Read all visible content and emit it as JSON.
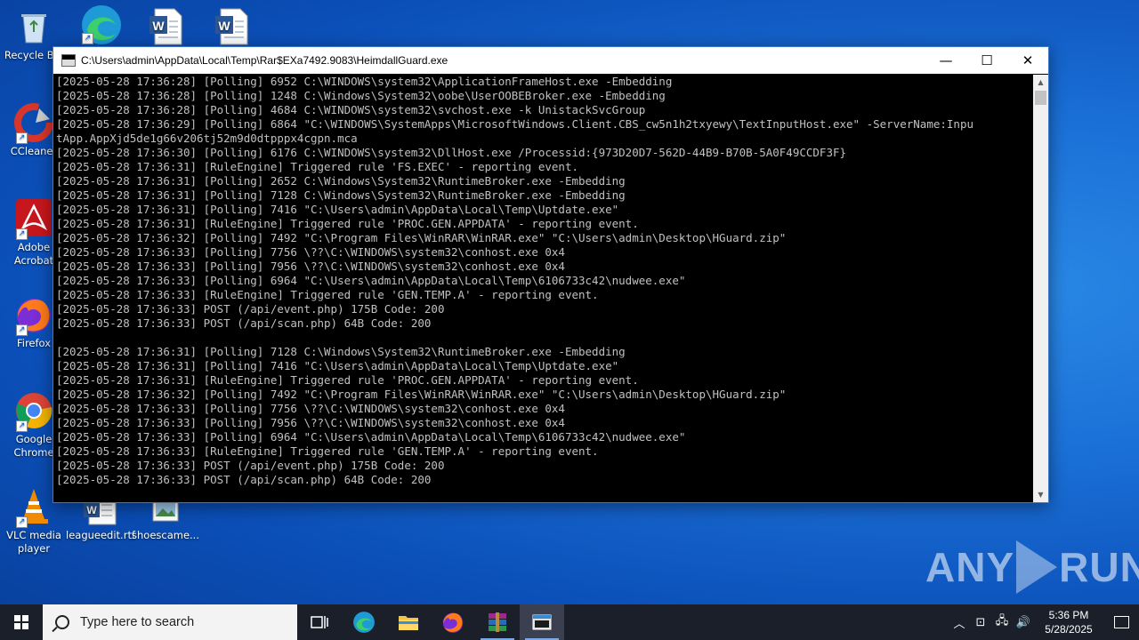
{
  "desktop": {
    "icons": [
      {
        "name": "recycle-bin",
        "label": "Recycle Bin"
      },
      {
        "name": "edge",
        "label": ""
      },
      {
        "name": "word-doc-1",
        "label": ""
      },
      {
        "name": "word-doc-2",
        "label": ""
      },
      {
        "name": "ccleaner",
        "label": "CCleaner"
      },
      {
        "name": "adobe-acrobat",
        "label": "Adobe Acrobat"
      },
      {
        "name": "firefox",
        "label": "Firefox"
      },
      {
        "name": "google-chrome",
        "label": "Google Chrome"
      },
      {
        "name": "vlc",
        "label": "VLC media player"
      },
      {
        "name": "leagueedit",
        "label": "leagueedit.rtf"
      },
      {
        "name": "shoescame",
        "label": "shoescame..."
      }
    ]
  },
  "window": {
    "title": "C:\\Users\\admin\\AppData\\Local\\Temp\\Rar$EXa7492.9083\\HeimdallGuard.exe",
    "minimize": "—",
    "maximize": "☐",
    "close": "✕",
    "console_lines": [
      "[2025-05-28 17:36:28] [Polling] 6952 C:\\WINDOWS\\system32\\ApplicationFrameHost.exe -Embedding",
      "[2025-05-28 17:36:28] [Polling] 1248 C:\\Windows\\System32\\oobe\\UserOOBEBroker.exe -Embedding",
      "[2025-05-28 17:36:28] [Polling] 4684 C:\\WINDOWS\\system32\\svchost.exe -k UnistackSvcGroup",
      "[2025-05-28 17:36:29] [Polling] 6864 \"C:\\WINDOWS\\SystemApps\\MicrosoftWindows.Client.CBS_cw5n1h2txyewy\\TextInputHost.exe\" -ServerName:Inpu",
      "tApp.AppXjd5de1g66v206tj52m9d0dtpppx4cgpn.mca",
      "[2025-05-28 17:36:30] [Polling] 6176 C:\\WINDOWS\\system32\\DllHost.exe /Processid:{973D20D7-562D-44B9-B70B-5A0F49CCDF3F}",
      "[2025-05-28 17:36:31] [RuleEngine] Triggered rule 'FS.EXEC' - reporting event.",
      "[2025-05-28 17:36:31] [Polling] 2652 C:\\Windows\\System32\\RuntimeBroker.exe -Embedding",
      "[2025-05-28 17:36:31] [Polling] 7128 C:\\Windows\\System32\\RuntimeBroker.exe -Embedding",
      "[2025-05-28 17:36:31] [Polling] 7416 \"C:\\Users\\admin\\AppData\\Local\\Temp\\Uptdate.exe\"",
      "[2025-05-28 17:36:31] [RuleEngine] Triggered rule 'PROC.GEN.APPDATA' - reporting event.",
      "[2025-05-28 17:36:32] [Polling] 7492 \"C:\\Program Files\\WinRAR\\WinRAR.exe\" \"C:\\Users\\admin\\Desktop\\HGuard.zip\"",
      "[2025-05-28 17:36:33] [Polling] 7756 \\??\\C:\\WINDOWS\\system32\\conhost.exe 0x4",
      "[2025-05-28 17:36:33] [Polling] 7956 \\??\\C:\\WINDOWS\\system32\\conhost.exe 0x4",
      "[2025-05-28 17:36:33] [Polling] 6964 \"C:\\Users\\admin\\AppData\\Local\\Temp\\6106733c42\\nudwee.exe\"",
      "[2025-05-28 17:36:33] [RuleEngine] Triggered rule 'GEN.TEMP.A' - reporting event.",
      "[2025-05-28 17:36:33] POST (/api/event.php) 175B Code: 200",
      "[2025-05-28 17:36:33] POST (/api/scan.php) 64B Code: 200",
      "",
      "[2025-05-28 17:36:31] [Polling] 7128 C:\\Windows\\System32\\RuntimeBroker.exe -Embedding",
      "[2025-05-28 17:36:31] [Polling] 7416 \"C:\\Users\\admin\\AppData\\Local\\Temp\\Uptdate.exe\"",
      "[2025-05-28 17:36:31] [RuleEngine] Triggered rule 'PROC.GEN.APPDATA' - reporting event.",
      "[2025-05-28 17:36:32] [Polling] 7492 \"C:\\Program Files\\WinRAR\\WinRAR.exe\" \"C:\\Users\\admin\\Desktop\\HGuard.zip\"",
      "[2025-05-28 17:36:33] [Polling] 7756 \\??\\C:\\WINDOWS\\system32\\conhost.exe 0x4",
      "[2025-05-28 17:36:33] [Polling] 7956 \\??\\C:\\WINDOWS\\system32\\conhost.exe 0x4",
      "[2025-05-28 17:36:33] [Polling] 6964 \"C:\\Users\\admin\\AppData\\Local\\Temp\\6106733c42\\nudwee.exe\"",
      "[2025-05-28 17:36:33] [RuleEngine] Triggered rule 'GEN.TEMP.A' - reporting event.",
      "[2025-05-28 17:36:33] POST (/api/event.php) 175B Code: 200",
      "[2025-05-28 17:36:33] POST (/api/scan.php) 64B Code: 200"
    ]
  },
  "watermark": {
    "left": "ANY",
    "right": "RUN"
  },
  "taskbar": {
    "search_placeholder": "Type here to search",
    "apps": [
      "task-view",
      "edge",
      "file-explorer",
      "firefox",
      "winrar",
      "console"
    ],
    "time": "5:36 PM",
    "date": "5/28/2025"
  }
}
